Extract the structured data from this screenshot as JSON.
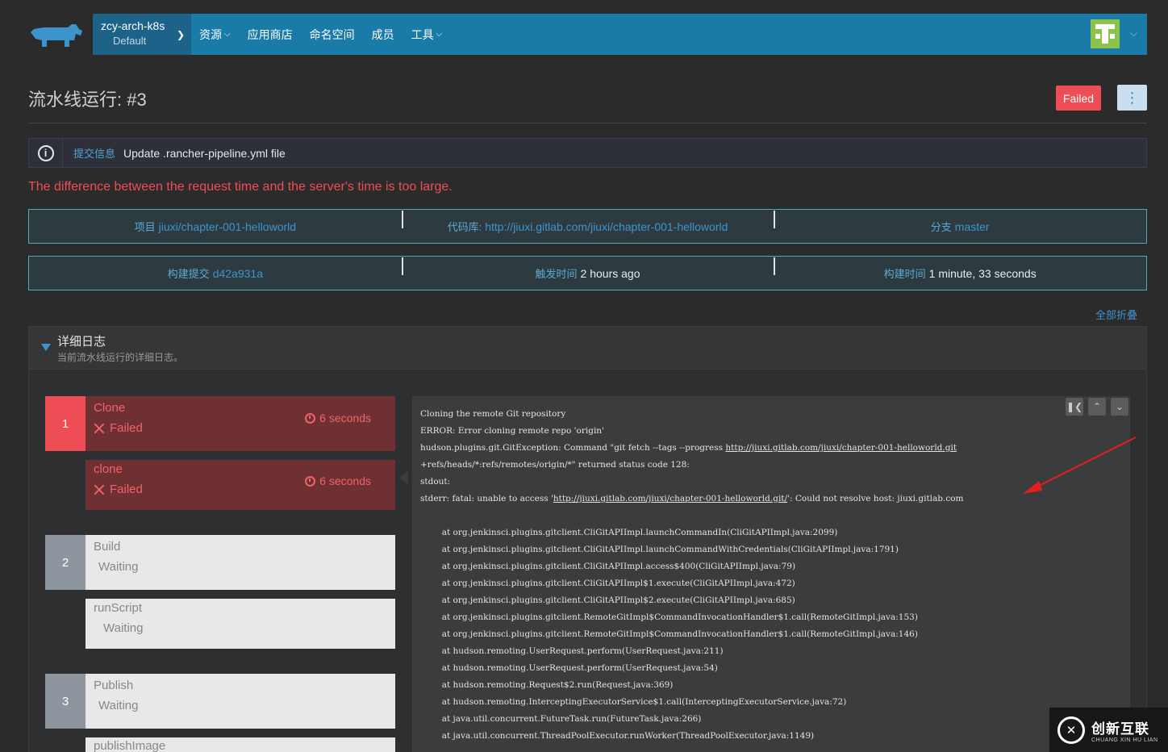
{
  "header": {
    "cluster_name": "zcy-arch-k8s",
    "project_name": "Default",
    "nav": [
      {
        "label": "资源",
        "has_dropdown": true
      },
      {
        "label": "应用商店",
        "has_dropdown": false
      },
      {
        "label": "命名空间",
        "has_dropdown": false
      },
      {
        "label": "成员",
        "has_dropdown": false
      },
      {
        "label": "工具",
        "has_dropdown": true
      }
    ]
  },
  "page": {
    "title": "流水线运行: #3",
    "status": "Failed"
  },
  "commit": {
    "label": "提交信息",
    "message": "Update .rancher-pipeline.yml file"
  },
  "error_message": "The difference between the request time and the server's time is too large.",
  "info_row1": {
    "project_label": "项目",
    "project_value": "jiuxi/chapter-001-helloworld",
    "repo_label": "代码库:",
    "repo_value": "http://jiuxi.gitlab.com/jiuxi/chapter-001-helloworld",
    "branch_label": "分支",
    "branch_value": "master"
  },
  "info_row2": {
    "commit_label": "构建提交",
    "commit_value": "d42a931a",
    "trigger_label": "触发时间",
    "trigger_value": "2 hours ago",
    "duration_label": "构建时间",
    "duration_value": "1 minute, 33 seconds"
  },
  "collapse_all": "全部折叠",
  "log_panel": {
    "title": "详细日志",
    "subtitle": "当前流水线运行的详细日志。"
  },
  "stages": [
    {
      "num": "1",
      "name": "Clone",
      "status": "Failed",
      "duration": "6 seconds"
    },
    {
      "num": "2",
      "name": "Build",
      "status": "Waiting"
    },
    {
      "num": "3",
      "name": "Publish",
      "status": "Waiting"
    }
  ],
  "steps": [
    {
      "name": "clone",
      "status": "Failed",
      "duration": "6 seconds"
    },
    {
      "name": "runScript",
      "status": "Waiting"
    },
    {
      "name": "publishImage",
      "status": ""
    }
  ],
  "console": {
    "lines": [
      "Cloning the remote Git repository",
      "ERROR: Error cloning remote repo 'origin'",
      "hudson.plugins.git.GitException: Command \"git fetch --tags --progress ",
      "+refs/heads/*:refs/remotes/origin/*\" returned status code 128:",
      "stdout:",
      "stderr: fatal: unable to access '",
      "",
      "        at org.jenkinsci.plugins.gitclient.CliGitAPIImpl.launchCommandIn(CliGitAPIImpl.java:2099)",
      "        at org.jenkinsci.plugins.gitclient.CliGitAPIImpl.launchCommandWithCredentials(CliGitAPIImpl.java:1791)",
      "        at org.jenkinsci.plugins.gitclient.CliGitAPIImpl.access$400(CliGitAPIImpl.java:79)",
      "        at org.jenkinsci.plugins.gitclient.CliGitAPIImpl$1.execute(CliGitAPIImpl.java:472)",
      "        at org.jenkinsci.plugins.gitclient.CliGitAPIImpl$2.execute(CliGitAPIImpl.java:685)",
      "        at org.jenkinsci.plugins.gitclient.RemoteGitImpl$CommandInvocationHandler$1.call(RemoteGitImpl.java:153)",
      "        at org.jenkinsci.plugins.gitclient.RemoteGitImpl$CommandInvocationHandler$1.call(RemoteGitImpl.java:146)",
      "        at hudson.remoting.UserRequest.perform(UserRequest.java:211)",
      "        at hudson.remoting.UserRequest.perform(UserRequest.java:54)",
      "        at hudson.remoting.Request$2.run(Request.java:369)",
      "        at hudson.remoting.InterceptingExecutorService$1.call(InterceptingExecutorService.java:72)",
      "        at java.util.concurrent.FutureTask.run(FutureTask.java:266)",
      "        at java.util.concurrent.ThreadPoolExecutor.runWorker(ThreadPoolExecutor.java:1149)"
    ],
    "link1": "http://jiuxi.gitlab.com/jiuxi/chapter-001-helloworld.git",
    "link2": "http://jiuxi.gitlab.com/jiuxi/chapter-001-helloworld.git/",
    "line6_tail": "': Could not resolve host: jiuxi.gitlab.com"
  },
  "watermark": {
    "cn": "创新互联",
    "en": "CHUANG XIN HU LIAN"
  },
  "colors": {
    "header": "#1a7aa8",
    "failed": "#ef4d55",
    "link": "#3d93cc"
  }
}
